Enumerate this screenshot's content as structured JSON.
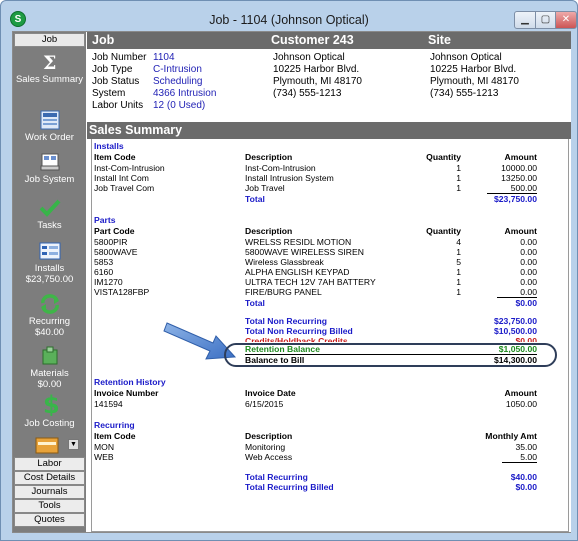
{
  "window": {
    "title": "Job - 1104 (Johnson Optical)",
    "icon": "S"
  },
  "sidebar": {
    "top_tab": "Job",
    "items": [
      {
        "label": "Sales Summary",
        "icon": "sigma-icon"
      },
      {
        "label": "Work Order",
        "icon": "work-order-icon"
      },
      {
        "label": "Job System",
        "icon": "job-system-icon"
      },
      {
        "label": "Tasks",
        "icon": "checkmark-icon"
      },
      {
        "label": "Installs",
        "sub": "$23,750.00",
        "icon": "installs-icon"
      },
      {
        "label": "Recurring",
        "sub": "$40.00",
        "icon": "recurring-icon"
      },
      {
        "label": "Materials",
        "sub": "$0.00",
        "icon": "materials-icon"
      },
      {
        "label": "Job Costing",
        "icon": "dollar-icon"
      }
    ],
    "bottom_items": [
      "Labor",
      "Cost Details",
      "Journals",
      "Tools",
      "Quotes"
    ]
  },
  "header": {
    "col1": "Job",
    "col2": "Customer 243",
    "col3": "Site"
  },
  "job": {
    "number_label": "Job Number",
    "number": "1104",
    "type_label": "Job Type",
    "type": "C-Intrusion",
    "status_label": "Job Status",
    "status": "Scheduling",
    "system_label": "System",
    "system": "4366 Intrusion",
    "units_label": "Labor Units",
    "units": "12 (0 Used)"
  },
  "customer": {
    "name": "Johnson Optical",
    "address": "10225 Harbor Blvd.",
    "city": "Plymouth, MI 48170",
    "phone": "(734) 555-1213"
  },
  "site": {
    "name": "Johnson Optical",
    "address": "10225 Harbor Blvd.",
    "city": "Plymouth, MI 48170",
    "phone": "(734) 555-1213"
  },
  "summary": {
    "title": "Sales Summary",
    "installs": {
      "heading": "Installs",
      "columns": [
        "Item Code",
        "Description",
        "Quantity",
        "Amount"
      ],
      "rows": [
        [
          "Inst-Com-Intrusion",
          "Inst-Com-Intrusion",
          "1",
          "10000.00"
        ],
        [
          "Install Int Com",
          "Install Intrusion System",
          "1",
          "13250.00"
        ],
        [
          "Job Travel Com",
          "Job Travel",
          "1",
          "500.00"
        ]
      ],
      "total_label": "Total",
      "total": "$23,750.00"
    },
    "parts": {
      "heading": "Parts",
      "columns": [
        "Part Code",
        "Description",
        "Quantity",
        "Amount"
      ],
      "rows": [
        [
          "5800PIR",
          "WRELSS RESIDL MOTION",
          "4",
          "0.00"
        ],
        [
          "5800WAVE",
          "5800WAVE WIRELESS SIREN",
          "1",
          "0.00"
        ],
        [
          "5853",
          "Wireless Glassbreak",
          "5",
          "0.00"
        ],
        [
          "6160",
          "ALPHA ENGLISH KEYPAD",
          "1",
          "0.00"
        ],
        [
          "IM1270",
          "ULTRA TECH 12V 7AH BATTERY",
          "1",
          "0.00"
        ],
        [
          "VISTA128FBP",
          "FIRE/BURG PANEL",
          "1",
          "0.00"
        ]
      ],
      "total_label": "Total",
      "total": "$0.00"
    },
    "totals": {
      "non_recurring_label": "Total Non Recurring",
      "non_recurring": "$23,750.00",
      "non_recurring_billed_label": "Total Non Recurring Billed",
      "non_recurring_billed": "$10,500.00",
      "credits_label": "Credits/Holdback Credits",
      "credits": "$0.00",
      "retention_label": "Retention Balance",
      "retention": "$1,050.00",
      "balance_label": "Balance to Bill",
      "balance": "$14,300.00"
    },
    "retention_history": {
      "heading": "Retention History",
      "columns": [
        "Invoice Number",
        "Invoice Date",
        "Amount"
      ],
      "rows": [
        [
          "141594",
          "6/15/2015",
          "1050.00"
        ]
      ]
    },
    "recurring": {
      "heading": "Recurring",
      "columns": [
        "Item Code",
        "Description",
        "Monthly Amt"
      ],
      "rows": [
        [
          "MON",
          "Monitoring",
          "35.00"
        ],
        [
          "WEB",
          "Web Access",
          "5.00"
        ]
      ],
      "total_label": "Total Recurring",
      "total": "$40.00",
      "billed_label": "Total Recurring Billed",
      "billed": "$0.00"
    }
  }
}
